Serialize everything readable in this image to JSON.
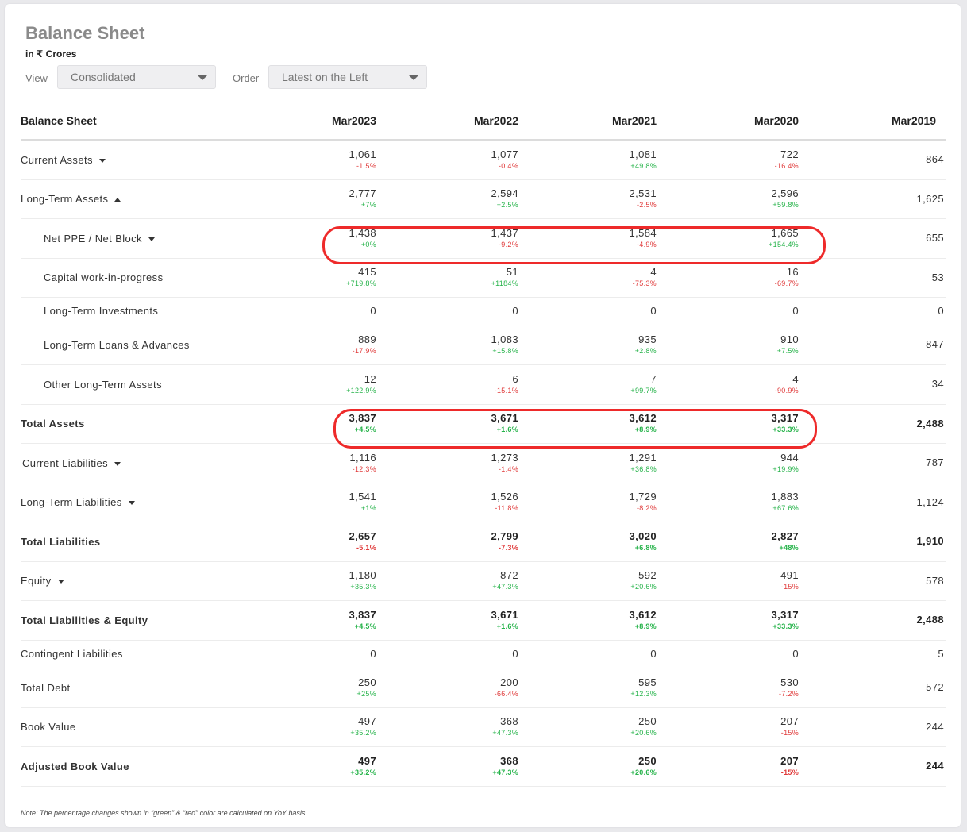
{
  "header": {
    "title": "Balance Sheet",
    "units": "in ₹ Crores",
    "view_label": "View",
    "view_value": "Consolidated",
    "order_label": "Order",
    "order_value": "Latest on the Left"
  },
  "table": {
    "columns": [
      "Balance Sheet",
      "Mar2023",
      "Mar2022",
      "Mar2021",
      "Mar2020",
      "Mar2019"
    ],
    "rows": [
      {
        "label": "Current Assets",
        "caret": "down",
        "indent": "",
        "bold": false,
        "values": [
          "1,061",
          "1,077",
          "1,081",
          "722",
          "864"
        ],
        "changes": [
          "-1.5%",
          "-0.4%",
          "+49.8%",
          "-16.4%"
        ]
      },
      {
        "label": "Long-Term Assets",
        "caret": "up",
        "indent": "",
        "bold": false,
        "values": [
          "2,777",
          "2,594",
          "2,531",
          "2,596",
          "1,625"
        ],
        "changes": [
          "+7%",
          "+2.5%",
          "-2.5%",
          "+59.8%"
        ]
      },
      {
        "label": "Net PPE / Net Block",
        "caret": "down",
        "indent": "sub",
        "bold": false,
        "values": [
          "1,438",
          "1,437",
          "1,584",
          "1,665",
          "655"
        ],
        "changes": [
          "+0%",
          "-9.2%",
          "-4.9%",
          "+154.4%"
        ]
      },
      {
        "label": "Capital work-in-progress",
        "caret": "",
        "indent": "sub",
        "bold": false,
        "values": [
          "415",
          "51",
          "4",
          "16",
          "53"
        ],
        "changes": [
          "+719.8%",
          "+1184%",
          "-75.3%",
          "-69.7%"
        ]
      },
      {
        "label": "Long-Term Investments",
        "caret": "",
        "indent": "sub",
        "bold": false,
        "values": [
          "0",
          "0",
          "0",
          "0",
          "0"
        ],
        "changes": [
          "",
          "",
          "",
          ""
        ]
      },
      {
        "label": "Long-Term Loans & Advances",
        "caret": "",
        "indent": "sub",
        "bold": false,
        "values": [
          "889",
          "1,083",
          "935",
          "910",
          "847"
        ],
        "changes": [
          "-17.9%",
          "+15.8%",
          "+2.8%",
          "+7.5%"
        ]
      },
      {
        "label": "Other Long-Term Assets",
        "caret": "",
        "indent": "sub",
        "bold": false,
        "values": [
          "12",
          "6",
          "7",
          "4",
          "34"
        ],
        "changes": [
          "+122.9%",
          "-15.1%",
          "+99.7%",
          "-90.9%"
        ]
      },
      {
        "label": "Total Assets",
        "caret": "",
        "indent": "",
        "bold": true,
        "values": [
          "3,837",
          "3,671",
          "3,612",
          "3,317",
          "2,488"
        ],
        "changes": [
          "+4.5%",
          "+1.6%",
          "+8.9%",
          "+33.3%"
        ]
      },
      {
        "label": "Current Liabilities",
        "caret": "down",
        "indent": "flush",
        "bold": false,
        "values": [
          "1,116",
          "1,273",
          "1,291",
          "944",
          "787"
        ],
        "changes": [
          "-12.3%",
          "-1.4%",
          "+36.8%",
          "+19.9%"
        ]
      },
      {
        "label": "Long-Term Liabilities",
        "caret": "down",
        "indent": "",
        "bold": false,
        "values": [
          "1,541",
          "1,526",
          "1,729",
          "1,883",
          "1,124"
        ],
        "changes": [
          "+1%",
          "-11.8%",
          "-8.2%",
          "+67.6%"
        ]
      },
      {
        "label": "Total Liabilities",
        "caret": "",
        "indent": "",
        "bold": true,
        "values": [
          "2,657",
          "2,799",
          "3,020",
          "2,827",
          "1,910"
        ],
        "changes": [
          "-5.1%",
          "-7.3%",
          "+6.8%",
          "+48%"
        ]
      },
      {
        "label": "Equity",
        "caret": "down",
        "indent": "",
        "bold": false,
        "values": [
          "1,180",
          "872",
          "592",
          "491",
          "578"
        ],
        "changes": [
          "+35.3%",
          "+47.3%",
          "+20.6%",
          "-15%"
        ]
      },
      {
        "label": "Total Liabilities & Equity",
        "caret": "",
        "indent": "",
        "bold": true,
        "values": [
          "3,837",
          "3,671",
          "3,612",
          "3,317",
          "2,488"
        ],
        "changes": [
          "+4.5%",
          "+1.6%",
          "+8.9%",
          "+33.3%"
        ]
      },
      {
        "label": "Contingent Liabilities",
        "caret": "",
        "indent": "",
        "bold": false,
        "values": [
          "0",
          "0",
          "0",
          "0",
          "5"
        ],
        "changes": [
          "",
          "",
          "",
          ""
        ]
      },
      {
        "label": "Total Debt",
        "caret": "",
        "indent": "",
        "bold": false,
        "values": [
          "250",
          "200",
          "595",
          "530",
          "572"
        ],
        "changes": [
          "+25%",
          "-66.4%",
          "+12.3%",
          "-7.2%"
        ]
      },
      {
        "label": "Book Value",
        "caret": "",
        "indent": "",
        "bold": false,
        "values": [
          "497",
          "368",
          "250",
          "207",
          "244"
        ],
        "changes": [
          "+35.2%",
          "+47.3%",
          "+20.6%",
          "-15%"
        ]
      },
      {
        "label": "Adjusted Book Value",
        "caret": "",
        "indent": "",
        "bold": true,
        "values": [
          "497",
          "368",
          "250",
          "207",
          "244"
        ],
        "changes": [
          "+35.2%",
          "+47.3%",
          "+20.6%",
          "-15%"
        ]
      }
    ]
  },
  "colors": {
    "positive": "#26b34a",
    "negative": "#e03a3a",
    "highlight": "#ee2a2a"
  },
  "footer": {
    "note": "Note: The percentage changes shown in “green” & “red” color are calculated on YoY basis."
  }
}
